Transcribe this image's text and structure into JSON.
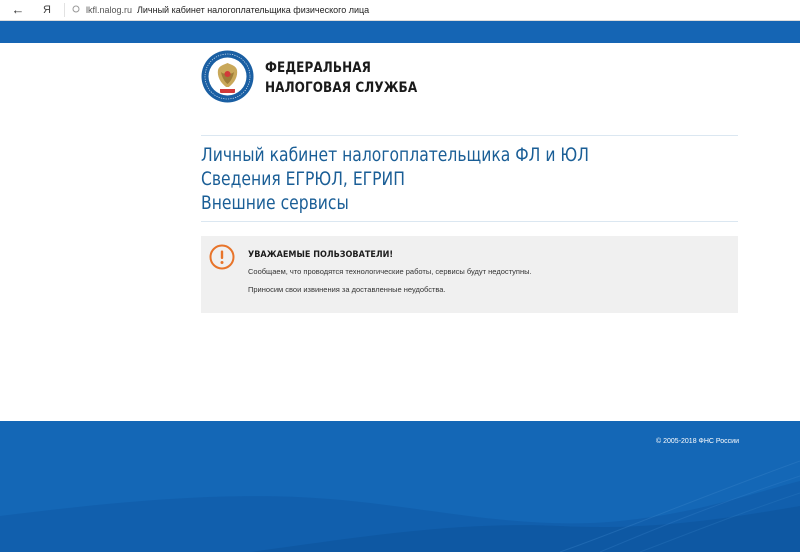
{
  "browser": {
    "back_icon": "arrow-left-icon",
    "yandex_label": "Я",
    "domain": "lkfl.nalog.ru",
    "tab_title": "Личный кабинет налогоплательщика физического лица"
  },
  "header": {
    "logo_icon": "fns-emblem-icon",
    "brand_line1": "ФЕДЕРАЛЬНАЯ",
    "brand_line2": "НАЛОГОВАЯ СЛУЖБА"
  },
  "links": [
    {
      "label": "Личный кабинет налогоплательщика ФЛ и ЮЛ"
    },
    {
      "label": "Сведения ЕГРЮЛ, ЕГРИП"
    },
    {
      "label": "Внешние сервисы"
    }
  ],
  "notice": {
    "icon": "exclamation-circle-icon",
    "title": "УВАЖАЕМЫЕ ПОЛЬЗОВАТЕЛИ!",
    "line1": "Сообщаем, что проводятся технологические работы, сервисы будут недоступны.",
    "line2": "Приносим свои извинения за доставленные неудобства."
  },
  "footer": {
    "copyright": "© 2005-2018 ФНС России"
  },
  "colors": {
    "brand_blue": "#1467b6",
    "link_blue": "#1a5e96",
    "warning_orange": "#e8742a",
    "notice_bg": "#f0f0f0"
  }
}
